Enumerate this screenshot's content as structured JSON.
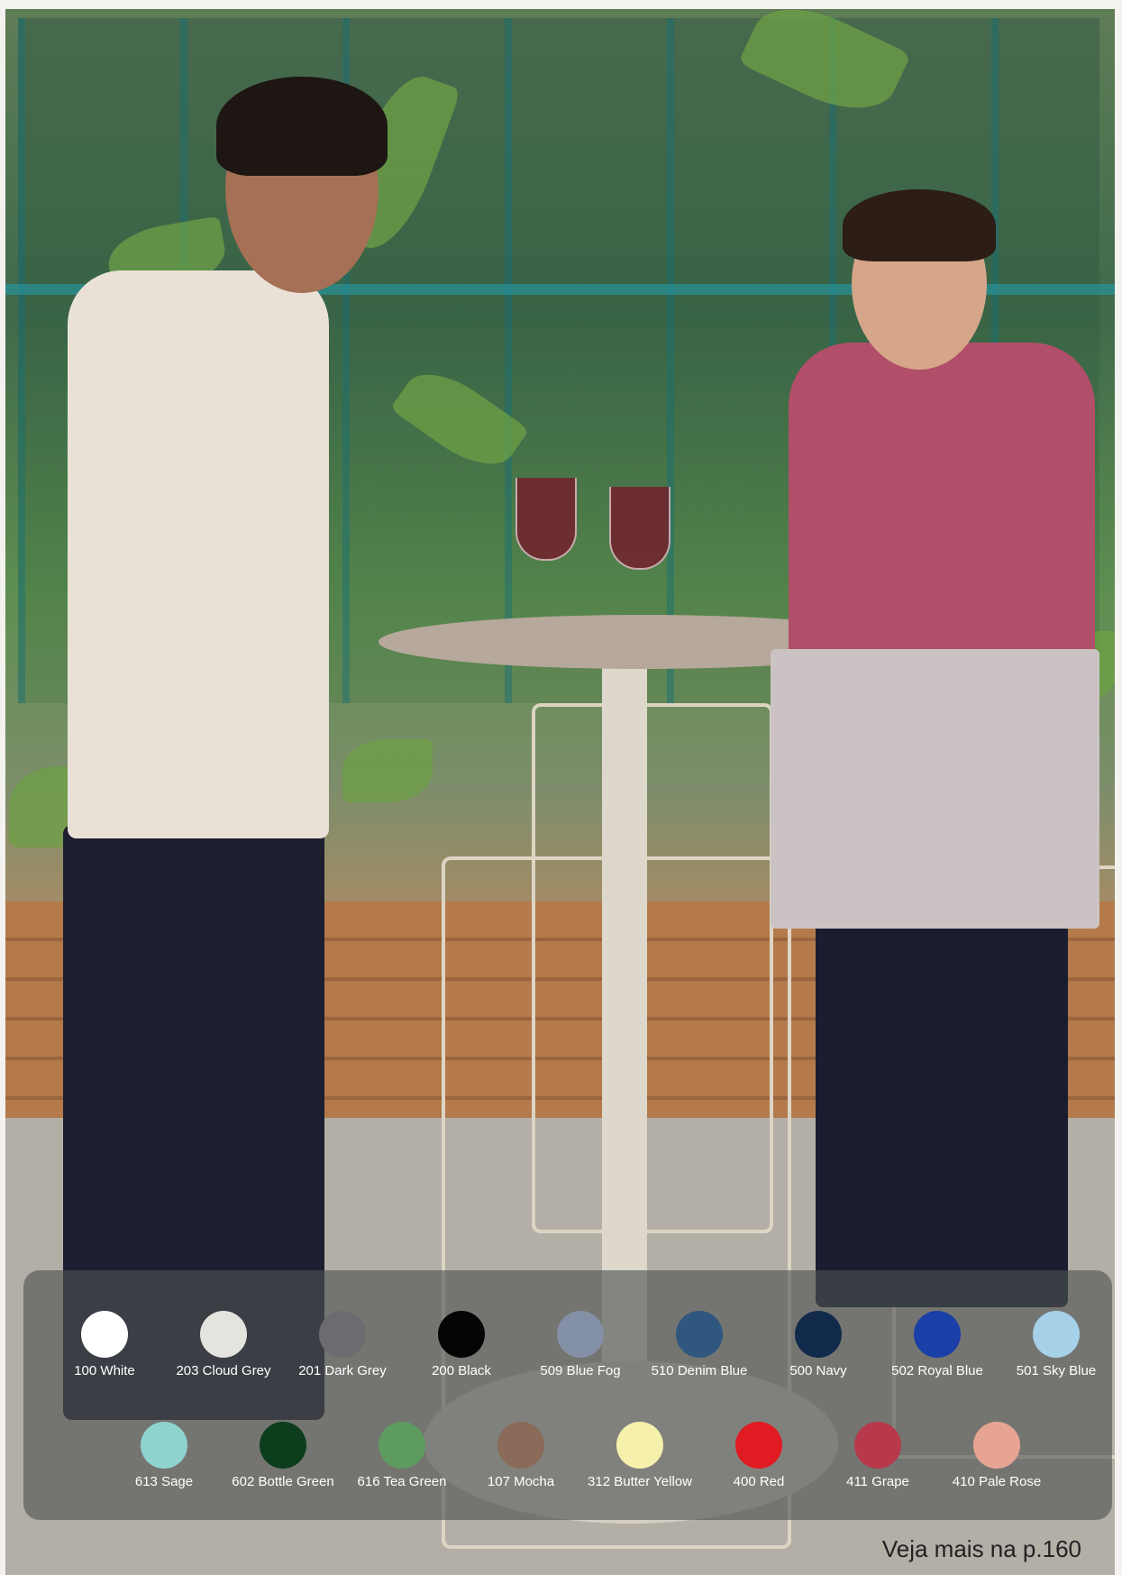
{
  "colors": {
    "row1": [
      {
        "label": "100 White",
        "hex": "#ffffff"
      },
      {
        "label": "203 Cloud Grey",
        "hex": "#e4e3de"
      },
      {
        "label": "201 Dark Grey",
        "hex": "#6c6c70"
      },
      {
        "label": "200 Black",
        "hex": "#050505"
      },
      {
        "label": "509 Blue Fog",
        "hex": "#8490a6"
      },
      {
        "label": "510 Denim Blue",
        "hex": "#2f5780"
      },
      {
        "label": "500 Navy",
        "hex": "#122a4c"
      },
      {
        "label": "502 Royal Blue",
        "hex": "#1a3fa6"
      },
      {
        "label": "501 Sky Blue",
        "hex": "#a6d1e8"
      }
    ],
    "row2": [
      {
        "label": "613 Sage",
        "hex": "#8fd3cf"
      },
      {
        "label": "602 Bottle Green",
        "hex": "#0c3d1c"
      },
      {
        "label": "616 Tea Green",
        "hex": "#5e9b5e"
      },
      {
        "label": "107 Mocha",
        "hex": "#8a6a58"
      },
      {
        "label": "312 Butter Yellow",
        "hex": "#f6f0ad"
      },
      {
        "label": "400 Red",
        "hex": "#e01b22"
      },
      {
        "label": "411 Grape",
        "hex": "#b8394a"
      },
      {
        "label": "410 Pale Rose",
        "hex": "#e8a493"
      }
    ]
  },
  "footer": {
    "note": "Veja mais na p.160"
  }
}
